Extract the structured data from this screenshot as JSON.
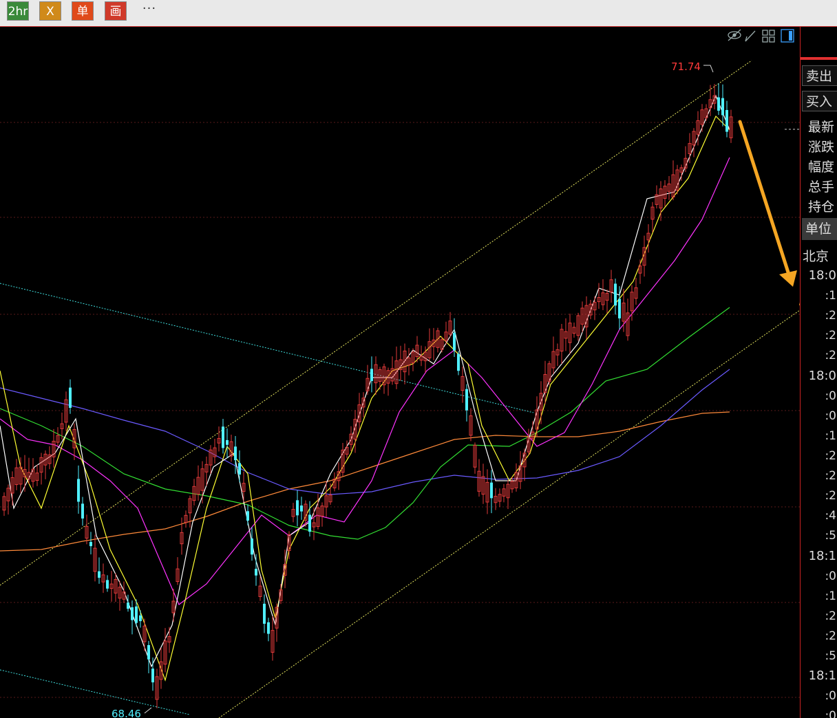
{
  "toolbar": {
    "buttons": [
      {
        "label": "2hr",
        "bg": "#3a8a3a"
      },
      {
        "label": "X",
        "bg": "#d08a1a"
      },
      {
        "label": "单",
        "bg": "#e04a1a"
      },
      {
        "label": "画",
        "bg": "#d03a2a"
      }
    ],
    "more": "···"
  },
  "chart": {
    "high_label": "71.74",
    "low_label": "68.46",
    "colors": {
      "up": "#e23a3a",
      "down": "#50f0ff",
      "ma5": "#ffffff",
      "ma10": "#ffff33",
      "ma20": "#ff33ff",
      "ma40": "#33e033",
      "ma60": "#6a5aff",
      "ma120": "#ff8a3a",
      "arrow": "#f5a623"
    }
  },
  "sidebar": {
    "sell": "卖出",
    "buy": "买入",
    "labels": [
      "最新",
      "涨跌",
      "幅度",
      "总手",
      "持仓"
    ],
    "unit": "单位",
    "beijing": "北京",
    "ticks": [
      "18:0",
      ":1",
      ":2",
      ":2",
      ":2",
      "18:0",
      ":0",
      ":0",
      ":1",
      ":2",
      ":2",
      ":2",
      ":4",
      ":5",
      "18:1",
      ":0",
      ":1",
      ":2",
      ":2",
      ":5",
      "18:1",
      ":0",
      ":0"
    ]
  }
}
